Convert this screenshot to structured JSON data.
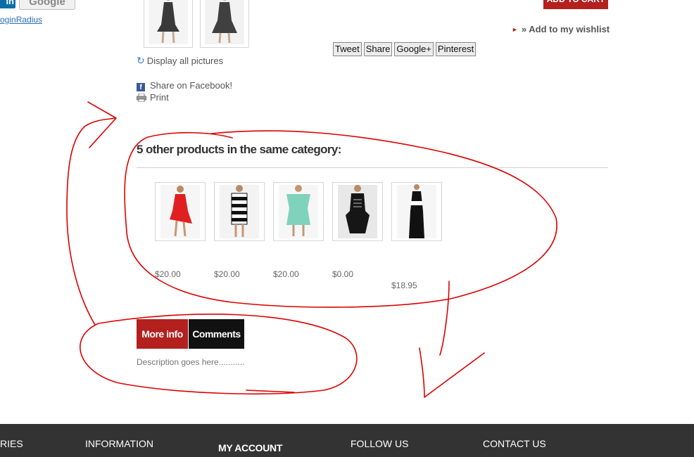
{
  "login": {
    "linkedin_label": "in",
    "google_label": "Google",
    "link_text": "oginRadius"
  },
  "product": {
    "add_to_cart": "ADD TO CART",
    "wishlist": "» Add to my wishlist",
    "display_all": "Display all pictures",
    "share_facebook": "Share on Facebook!",
    "print": "Print"
  },
  "social_buttons": [
    "Tweet",
    "Share",
    "Google+",
    "Pinterest"
  ],
  "same_category": {
    "title": "5 other products in the same category:",
    "prices": [
      "$20.00",
      "$20.00",
      "$20.00",
      "$0.00",
      "$18.95"
    ]
  },
  "tabs": {
    "more_info": "More info",
    "comments": "Comments"
  },
  "description": "Description goes here...........",
  "footer": {
    "columns": [
      "RIES",
      "INFORMATION",
      "MY ACCOUNT",
      "FOLLOW US",
      "CONTACT US"
    ]
  },
  "colors": {
    "accent_red": "#b3201e",
    "footer_bg": "#333333",
    "annotation": "#dd0000"
  }
}
